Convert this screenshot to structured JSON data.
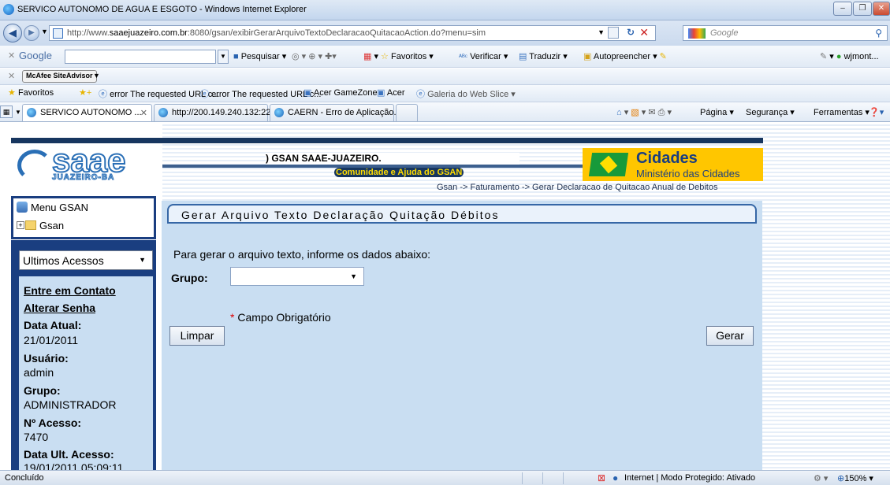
{
  "window": {
    "title": "SERVICO AUTONOMO DE AGUA E ESGOTO - Windows Internet Explorer"
  },
  "addressbar": {
    "url_prefix": "http://www.",
    "url_domain": "saaejuazeiro.com.br",
    "url_rest": ":8080/gsan/exibirGerarArquivoTextoDeclaracaoQuitacaoAction.do?menu=sim",
    "search_placeholder": "Google"
  },
  "google_toolbar": {
    "brand": "Google",
    "pesquisar": "Pesquisar",
    "favoritos": "Favoritos",
    "verificar": "Verificar",
    "traduzir": "Traduzir",
    "autopreencher": "Autopreencher",
    "account": "wjmont..."
  },
  "mcafee_toolbar": {
    "label": "McAfee SiteAdvisor"
  },
  "favorites_bar": {
    "favoritos": "Favoritos",
    "items": [
      "error The requested URL c...",
      "error The requested URL c...",
      "Acer GameZone",
      "Acer",
      "Galeria do Web Slice"
    ]
  },
  "tabs": [
    {
      "label": "SERVICO AUTONOMO ..."
    },
    {
      "label": "http://200.149.240.132:222..."
    },
    {
      "label": "CAERN - Erro de Aplicação..."
    }
  ],
  "command_bar": {
    "pagina": "Página",
    "seguranca": "Segurança",
    "ferramentas": "Ferramentas"
  },
  "header": {
    "logo_main": "saae",
    "logo_sub": "JUAZEIRO-BA",
    "system_title": ") GSAN SAAE-JUAZEIRO.",
    "community_link": "Comunidade e Ajuda do GSAN",
    "cidades_title": "Cidades",
    "cidades_sub": "Ministério das Cidades",
    "breadcrumb": "Gsan -> Faturamento -> Gerar Declaracao de Quitacao Anual de Debitos"
  },
  "sidebar": {
    "menu_title": "Menu GSAN",
    "tree_root": "Gsan",
    "recent_select": "Ultimos Acessos",
    "contact_link": "Entre em Contato",
    "password_link": "Alterar Senha",
    "date_label": "Data Atual:",
    "date_value": "21/01/2011",
    "user_label": "Usuário:",
    "user_value": "admin",
    "group_label": "Grupo:",
    "group_value": "ADMINISTRADOR",
    "access_label": "Nº Acesso:",
    "access_value": "7470",
    "last_access_label": "Data Ult. Acesso:",
    "last_access_value": "19/01/2011 05:09:11"
  },
  "form": {
    "title": "Gerar Arquivo Texto Declaração Quitação Débitos",
    "intro": "Para gerar o arquivo texto, informe os dados abaixo:",
    "grupo_label": "Grupo:",
    "grupo_value": "",
    "required_mark": "*",
    "required_note": "Campo Obrigatório",
    "clear_button": "Limpar",
    "generate_button": "Gerar"
  },
  "statusbar": {
    "status": "Concluído",
    "zone": "Internet | Modo Protegido: Ativado",
    "zoom": "150%"
  }
}
